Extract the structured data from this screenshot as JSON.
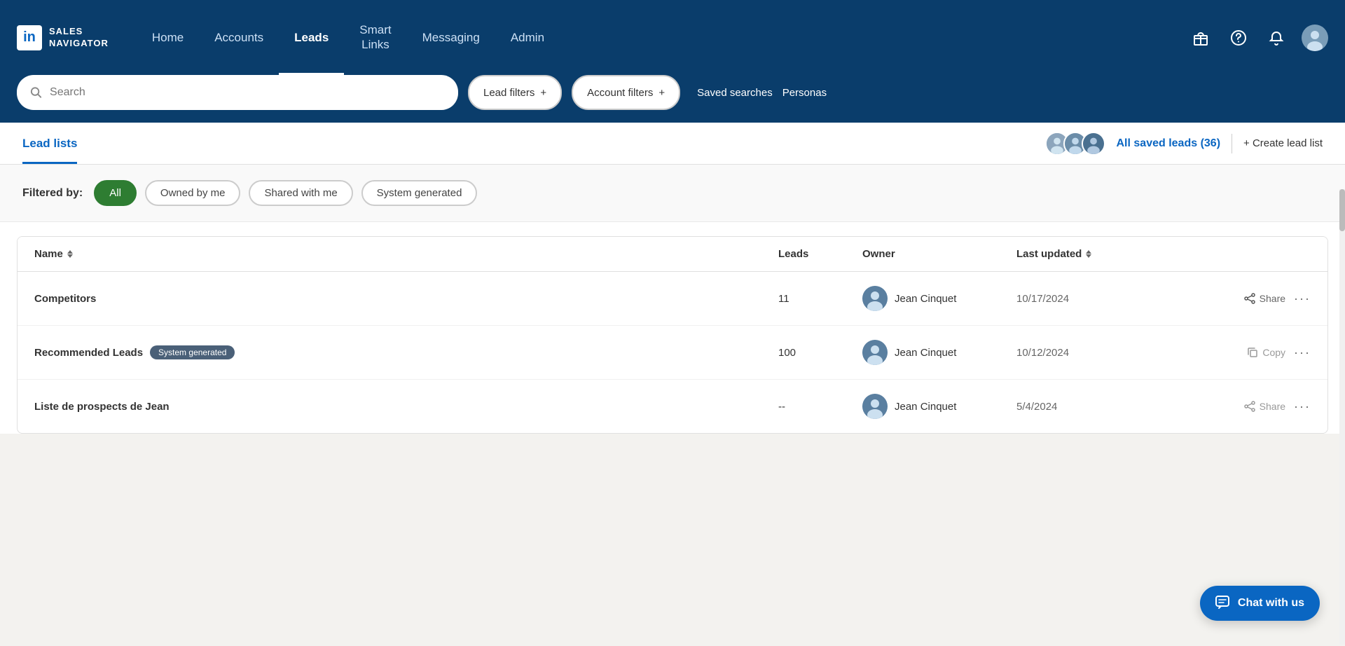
{
  "app": {
    "logo_in": "in",
    "logo_text_line1": "SALES",
    "logo_text_line2": "NAVIGATOR"
  },
  "nav": {
    "home_label": "Home",
    "accounts_label": "Accounts",
    "leads_label": "Leads",
    "smart_links_line1": "Smart",
    "smart_links_line2": "Links",
    "messaging_label": "Messaging",
    "admin_label": "Admin"
  },
  "search": {
    "placeholder": "Search",
    "lead_filters_label": "Lead filters",
    "account_filters_label": "Account filters",
    "plus": "+",
    "saved_searches_label": "Saved searches",
    "personas_label": "Personas"
  },
  "lead_lists": {
    "tab_label": "Lead lists",
    "all_saved_leads_label": "All saved leads (36)",
    "create_lead_list_label": "+ Create lead list"
  },
  "filter_pills": {
    "filtered_by_label": "Filtered by:",
    "all_label": "All",
    "owned_by_me_label": "Owned by me",
    "shared_with_me_label": "Shared with me",
    "system_generated_label": "System generated"
  },
  "table": {
    "col_name": "Name",
    "col_leads": "Leads",
    "col_owner": "Owner",
    "col_last_updated": "Last updated",
    "rows": [
      {
        "name": "Competitors",
        "badge": null,
        "leads": "11",
        "owner": "Jean Cinquet",
        "last_updated": "10/17/2024",
        "action": "Share",
        "action_icon": "share"
      },
      {
        "name": "Recommended Leads",
        "badge": "System generated",
        "leads": "100",
        "owner": "Jean Cinquet",
        "last_updated": "10/12/2024",
        "action": "Copy",
        "action_icon": "copy"
      },
      {
        "name": "Liste de prospects de Jean",
        "badge": null,
        "leads": "--",
        "owner": "Jean Cinquet",
        "last_updated": "5/4/2024",
        "action": "Share",
        "action_icon": "share"
      }
    ]
  },
  "chat": {
    "label": "Chat with us"
  }
}
